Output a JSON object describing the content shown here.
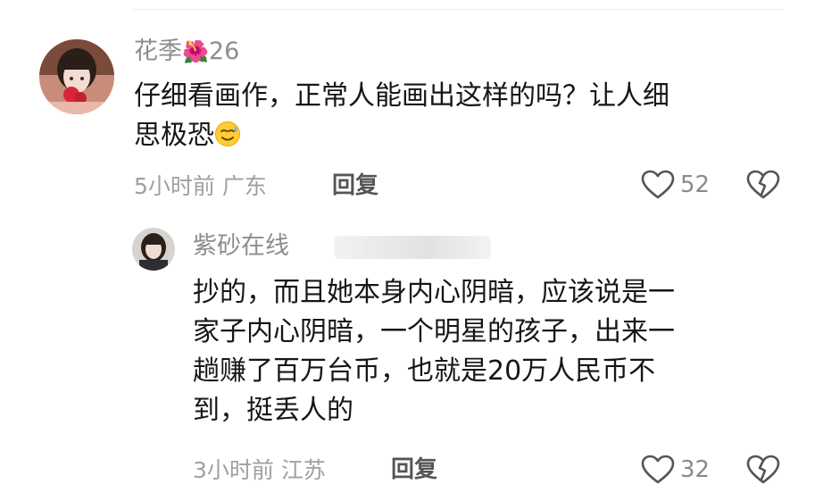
{
  "comment": {
    "username": "花季",
    "username_emoji": "🌺",
    "username_suffix": "26",
    "text": "仔细看画作，正常人能画出这样的吗？让人细思极恐",
    "text_line1": "仔细看画作，正常人能画出这样的吗？让人细",
    "text_line2": "思极恐",
    "emoji": "sweat-smile-emoji",
    "time": "5小时前",
    "location": "广东",
    "reply_label": "回复",
    "like_count": "52"
  },
  "reply": {
    "username": "紫砂在线",
    "text_lines": [
      "抄的，而且她本身内心阴暗，应该说是一",
      "家子内心阴暗，一个明星的孩子，出来一",
      "趟赚了百万台币，也就是20万人民币不",
      "到，挺丢人的"
    ],
    "time": "3小时前",
    "location": "江苏",
    "reply_label": "回复",
    "like_count": "32"
  },
  "icons": {
    "like": "heart-outline-icon",
    "dislike": "broken-heart-icon"
  },
  "colors": {
    "username": "#8d8d8d",
    "text": "#161616",
    "meta": "#a0a0a0",
    "reply_button": "#555555"
  }
}
